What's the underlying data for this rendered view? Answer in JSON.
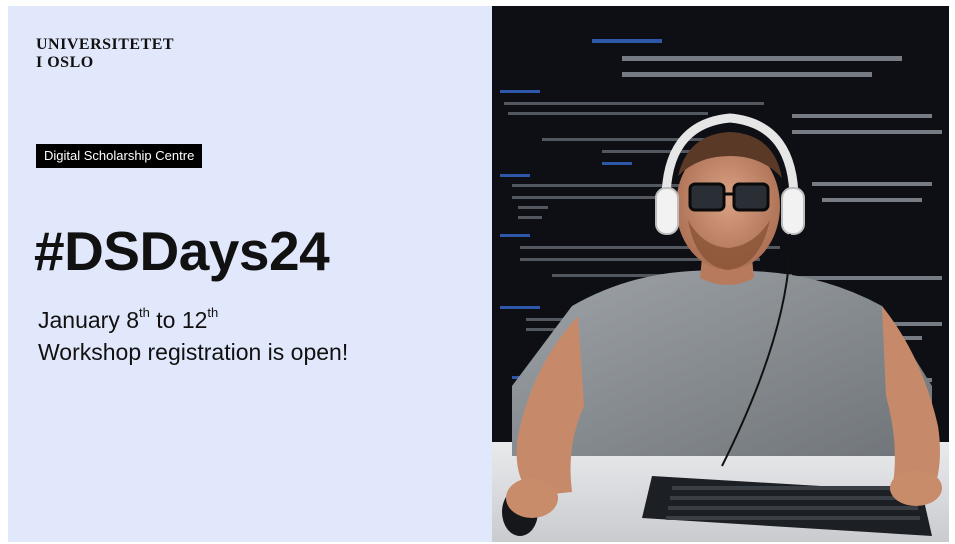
{
  "logo": {
    "line1": "UNIVERSITETET",
    "line2": "I OSLO"
  },
  "centre_tag": "Digital Scholarship Centre",
  "hashtag": "#DSDays24",
  "dates": {
    "prefix": "January 8",
    "sup1": "th",
    "middle": " to 12",
    "sup2": "th",
    "registration": "Workshop registration is open!"
  },
  "colors": {
    "left_bg": "#e2e8fb",
    "tag_bg": "#000000",
    "photo_bg": "#0d0f14",
    "code_accent": "#3b6fd8"
  },
  "photo": {
    "icon": "person-with-headphones-coding-photo"
  }
}
